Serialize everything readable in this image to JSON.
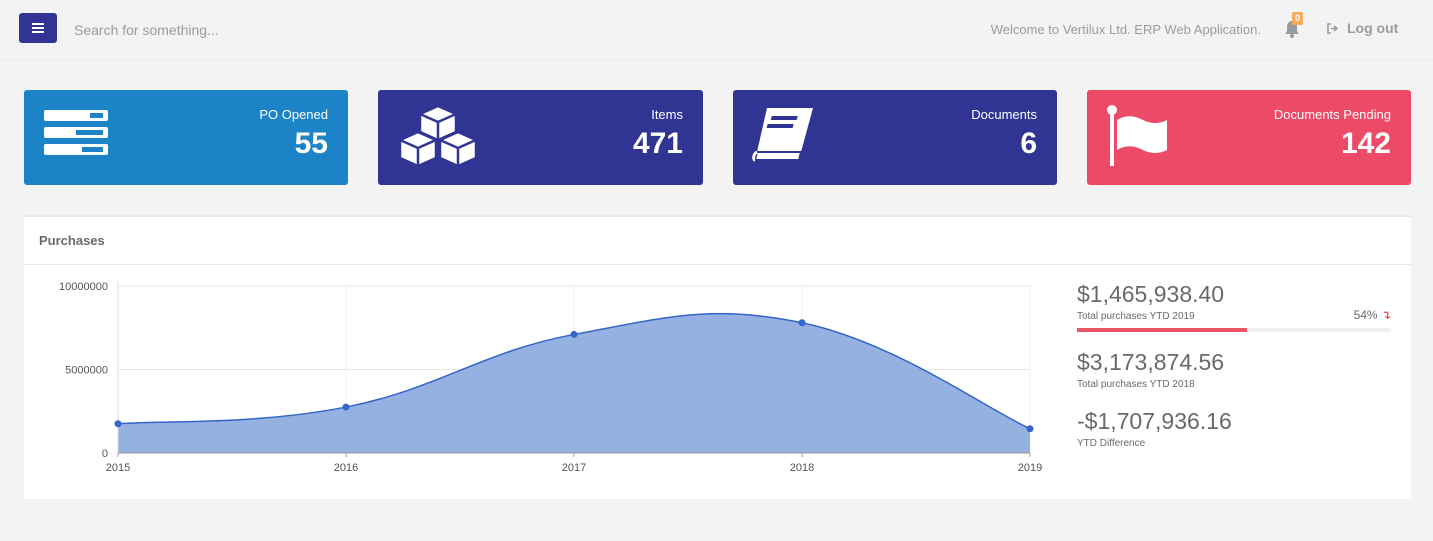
{
  "header": {
    "search_placeholder": "Search for something...",
    "welcome": "Welcome to Vertilux Ltd. ERP Web Application.",
    "notification_count": "0",
    "logout_label": "Log out",
    "menu_icon": "bars-icon",
    "bell_icon": "bell-icon",
    "logout_icon": "sign-out-icon"
  },
  "cards": [
    {
      "label": "PO Opened",
      "value": "55",
      "color": "#1c84c6",
      "icon": "tasks-icon"
    },
    {
      "label": "Items",
      "value": "471",
      "color": "#303593",
      "icon": "cubes-icon"
    },
    {
      "label": "Documents",
      "value": "6",
      "color": "#303593",
      "icon": "book-icon"
    },
    {
      "label": "Documents Pending",
      "value": "142",
      "color": "#ed4a67",
      "icon": "flag-icon"
    }
  ],
  "purchases": {
    "title": "Purchases",
    "stats": [
      {
        "value": "$1,465,938.40",
        "label": "Total purchases YTD 2019",
        "percent_text": "54%",
        "progress": 0.54,
        "progress_color": "#ed5565"
      },
      {
        "value": "$3,173,874.56",
        "label": "Total purchases YTD 2018"
      },
      {
        "value": "-$1,707,936.16",
        "label": "YTD Difference"
      }
    ]
  },
  "chart_data": {
    "type": "area",
    "x": [
      "2015",
      "2016",
      "2017",
      "2018",
      "2019"
    ],
    "series": [
      {
        "values": [
          1750000,
          2750000,
          7100000,
          7800000,
          1450000
        ]
      }
    ],
    "y_ticks": [
      "0",
      "5000000",
      "10000000"
    ],
    "ylim": [
      0,
      10000000
    ],
    "grid": true,
    "fill_color": "#94b1e2",
    "line_color": "#3465c8"
  }
}
